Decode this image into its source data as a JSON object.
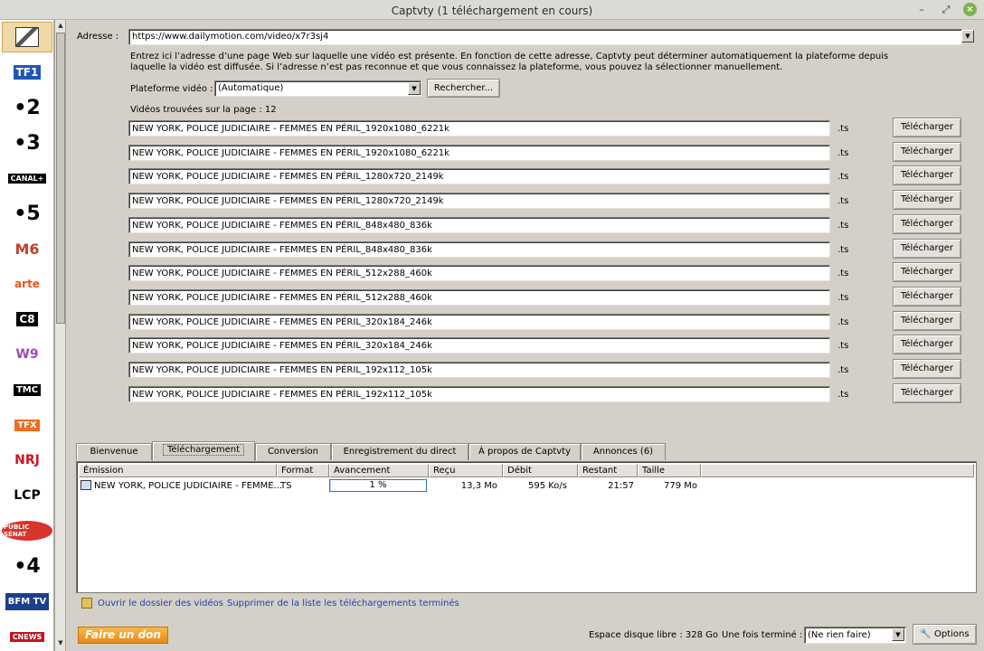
{
  "window": {
    "title": "Captvty (1 téléchargement en cours)"
  },
  "channels": [
    {
      "name": "captvty-logo",
      "text": "",
      "color": "#222222"
    },
    {
      "name": "tf1",
      "text": "TF1",
      "color": "#1e56b8"
    },
    {
      "name": "france-2",
      "text": "•2",
      "color": "#000000"
    },
    {
      "name": "france-3",
      "text": "•3",
      "color": "#000000"
    },
    {
      "name": "canal-plus",
      "text": "CANAL+",
      "color": "#000000"
    },
    {
      "name": "france-5",
      "text": "•5",
      "color": "#000000"
    },
    {
      "name": "m6",
      "text": "M6",
      "color": "#c83c2a"
    },
    {
      "name": "arte",
      "text": "arte",
      "color": "#e8551c"
    },
    {
      "name": "c8",
      "text": "C8",
      "color": "#000000"
    },
    {
      "name": "w9",
      "text": "W9",
      "color": "#a04bb3"
    },
    {
      "name": "tmc",
      "text": "TMC",
      "color": "#000000"
    },
    {
      "name": "tfx",
      "text": "TFX",
      "color": "#ef6b1e"
    },
    {
      "name": "nrj12",
      "text": "NRJ",
      "color": "#d1121f"
    },
    {
      "name": "lcp",
      "text": "LCP",
      "color": "#000000"
    },
    {
      "name": "public-senat",
      "text": "PUBLIC SÉNAT",
      "color": "#d8342a"
    },
    {
      "name": "france-4",
      "text": "•4",
      "color": "#000000"
    },
    {
      "name": "bfmtv",
      "text": "BFM TV",
      "color": "#1c3f8c"
    },
    {
      "name": "cnews",
      "text": "CNEWS",
      "color": "#c4141c"
    }
  ],
  "address": {
    "label": "Adresse :",
    "value": "https://www.dailymotion.com/video/x7r3sj4",
    "help": "Entrez ici l’adresse d’une page Web sur laquelle une vidéo est présente. En fonction de cette adresse, Captvty peut déterminer automatiquement la plateforme depuis laquelle la vidéo est diffusée. Si l’adresse n’est pas reconnue et que vous connaissez la plateforme, vous pouvez la sélectionner manuellement."
  },
  "platform": {
    "label": "Plateforme vidéo :",
    "value": "(Automatique)",
    "search_button": "Rechercher..."
  },
  "videos": {
    "found_label": "Vidéos trouvées sur la page : 12",
    "download_label": "Télécharger",
    "items": [
      {
        "title": "NEW YORK, POLICE JUDICIAIRE - FEMMES EN PÉRIL_1920x1080_6221k",
        "ext": ".ts"
      },
      {
        "title": "NEW YORK, POLICE JUDICIAIRE - FEMMES EN PÉRIL_1920x1080_6221k",
        "ext": ".ts"
      },
      {
        "title": "NEW YORK, POLICE JUDICIAIRE - FEMMES EN PÉRIL_1280x720_2149k",
        "ext": ".ts"
      },
      {
        "title": "NEW YORK, POLICE JUDICIAIRE - FEMMES EN PÉRIL_1280x720_2149k",
        "ext": ".ts"
      },
      {
        "title": "NEW YORK, POLICE JUDICIAIRE - FEMMES EN PÉRIL_848x480_836k",
        "ext": ".ts"
      },
      {
        "title": "NEW YORK, POLICE JUDICIAIRE - FEMMES EN PÉRIL_848x480_836k",
        "ext": ".ts"
      },
      {
        "title": "NEW YORK, POLICE JUDICIAIRE - FEMMES EN PÉRIL_512x288_460k",
        "ext": ".ts"
      },
      {
        "title": "NEW YORK, POLICE JUDICIAIRE - FEMMES EN PÉRIL_512x288_460k",
        "ext": ".ts"
      },
      {
        "title": "NEW YORK, POLICE JUDICIAIRE - FEMMES EN PÉRIL_320x184_246k",
        "ext": ".ts"
      },
      {
        "title": "NEW YORK, POLICE JUDICIAIRE - FEMMES EN PÉRIL_320x184_246k",
        "ext": ".ts"
      },
      {
        "title": "NEW YORK, POLICE JUDICIAIRE - FEMMES EN PÉRIL_192x112_105k",
        "ext": ".ts"
      },
      {
        "title": "NEW YORK, POLICE JUDICIAIRE - FEMMES EN PÉRIL_192x112_105k",
        "ext": ".ts"
      }
    ]
  },
  "tabs": [
    {
      "label": "Bienvenue",
      "active": false
    },
    {
      "label": "Téléchargement",
      "active": true
    },
    {
      "label": "Conversion",
      "active": false
    },
    {
      "label": "Enregistrement du direct",
      "active": false
    },
    {
      "label": "À propos de Captvty",
      "active": false
    },
    {
      "label": "Annonces (6)",
      "active": false
    }
  ],
  "downloads": {
    "columns": [
      "Émission",
      "Format",
      "Avancement",
      "Reçu",
      "Débit",
      "Restant",
      "Taille"
    ],
    "rows": [
      {
        "emission": "NEW YORK, POLICE JUDICIAIRE - FEMME...",
        "format": "TS",
        "progress_text": "1 %",
        "progress": 1,
        "recu": "13,3 Mo",
        "debit": "595 Ko/s",
        "restant": "21:57",
        "taille": "779 Mo"
      }
    ]
  },
  "links": {
    "open_folder": "Ouvrir le dossier des vidéos",
    "remove_finished": "Supprimer de la liste les téléchargements terminés"
  },
  "footer": {
    "donate": "Faire un don",
    "disk_space": "Espace disque libre : 328 Go",
    "when_done_label": "Une fois terminé :",
    "when_done_value": "(Ne rien faire)",
    "options": "Options"
  }
}
